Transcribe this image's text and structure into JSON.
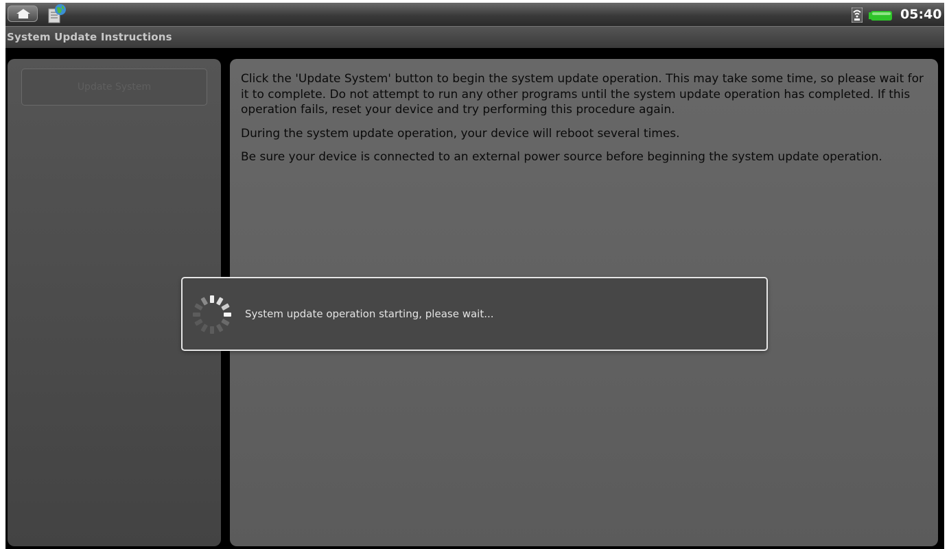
{
  "status_bar": {
    "time": "05:40",
    "icons": [
      "home-icon",
      "app-globe-icon",
      "signal-icon",
      "battery-icon"
    ],
    "battery_color": "#2fc42a"
  },
  "title_bar": {
    "title": "System Update Instructions"
  },
  "left_panel": {
    "update_button_label": "Update System",
    "update_button_state": "disabled"
  },
  "instructions": {
    "paragraphs": [
      "Click the 'Update System' button to begin the system update operation. This may take some time, so please wait for it to complete. Do not attempt to run any other programs until the system update operation has completed. If this operation fails, reset your device and try performing this procedure again.",
      "During the system update operation, your device will reboot several times.",
      "Be sure your device is connected to an external power source before beginning the system update operation."
    ]
  },
  "dialog": {
    "message": "System update operation starting, please wait...",
    "icon": "loading-spinner-icon"
  }
}
